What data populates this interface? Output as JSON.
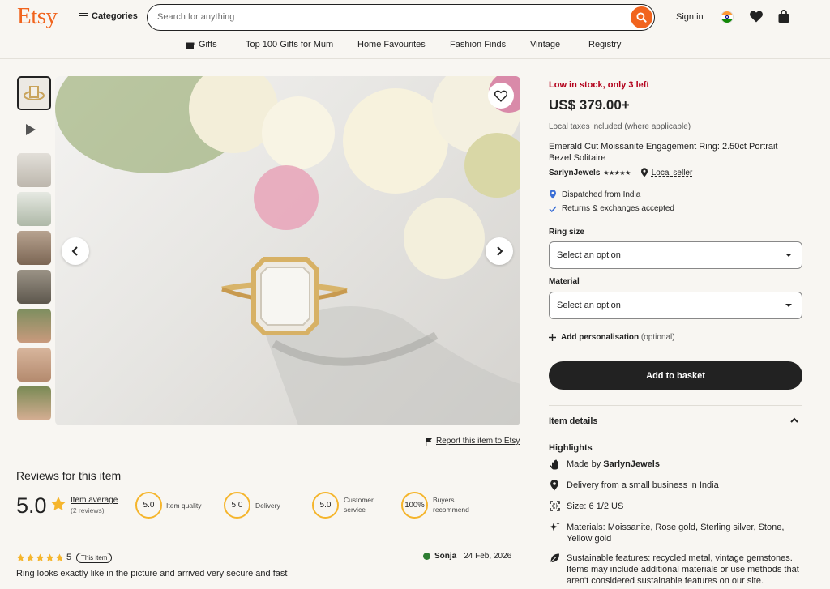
{
  "header": {
    "logo": "Etsy",
    "categories_label": "Categories",
    "search_placeholder": "Search for anything",
    "signin_label": "Sign in"
  },
  "nav": {
    "items": [
      "Gifts",
      "Top 100 Gifts for Mum",
      "Home Favourites",
      "Fashion Finds",
      "Vintage",
      "Registry"
    ]
  },
  "gallery": {
    "report_label": "Report this item to Etsy"
  },
  "reviews": {
    "title": "Reviews for this item",
    "average": "5.0",
    "average_label": "Item average",
    "review_count": "(2 reviews)",
    "metrics": [
      {
        "value": "5.0",
        "label": "Item quality"
      },
      {
        "value": "5.0",
        "label": "Delivery"
      },
      {
        "value": "5.0",
        "label": "Customer service"
      },
      {
        "value": "100%",
        "label": "Buyers recommend"
      }
    ],
    "first": {
      "rating": "5",
      "badge": "This item",
      "user": "Sonja",
      "date": "24 Feb, 2026",
      "text": "Ring looks exactly like in the picture and arrived very secure and fast"
    }
  },
  "product": {
    "stock": "Low in stock, only 3 left",
    "price": "US$ 379.00+",
    "tax": "Local taxes included (where applicable)",
    "title": "Emerald Cut Moissanite Engagement Ring: 2.50ct Portrait Bezel Solitaire",
    "seller": "SarlynJewels",
    "seller_rating": "★★★★★",
    "local_seller": "Local seller",
    "dispatched": "Dispatched from India",
    "returns": "Returns & exchanges accepted",
    "ring_size_label": "Ring size",
    "ring_size_value": "Select an option",
    "material_label": "Material",
    "material_value": "Select an option",
    "personalise": "Add personalisation",
    "personalise_optional": "(optional)",
    "basket_label": "Add to basket",
    "item_details": "Item details",
    "highlights": "Highlights",
    "made_by_prefix": "Made by",
    "made_by_seller": "SarlynJewels",
    "delivery": "Delivery from a small business in India",
    "size": "Size: 6 1/2 US",
    "materials": "Materials: Moissanite, Rose gold, Sterling silver, Stone, Yellow gold",
    "sustainable": "Sustainable features: recycled metal, vintage gemstones. Items may include additional materials or use methods that aren't considered sustainable features on our site."
  },
  "colors": {
    "brand": "#f1641e",
    "stock": "#b3001b",
    "badge_ring": "#f5b52c",
    "dark": "#222222"
  }
}
